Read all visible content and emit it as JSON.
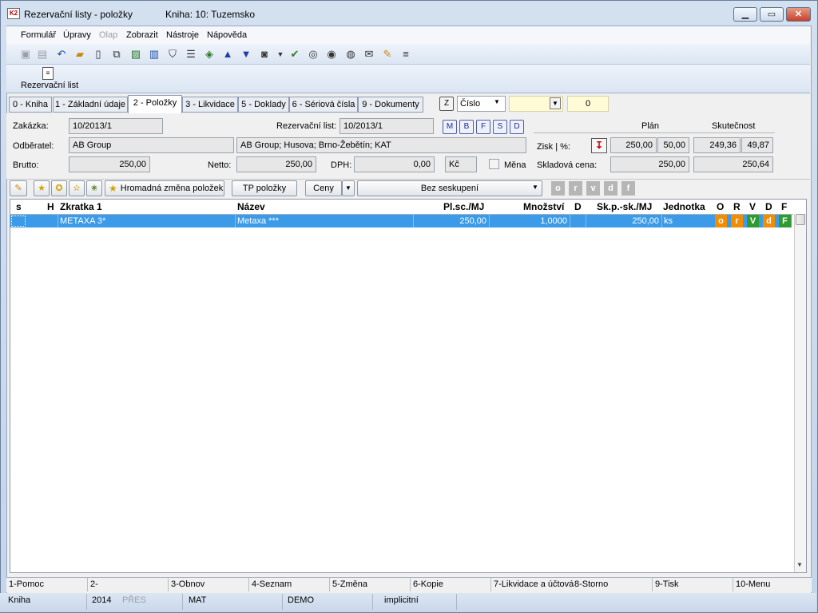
{
  "window": {
    "title": "Rezervační listy - položky",
    "book": "Kniha: 10: Tuzemsko",
    "icon_text": "K2",
    "controls": {
      "minimize": "▁",
      "maximize": "▭",
      "close": "✕"
    }
  },
  "menu": [
    "Formulář",
    "Úpravy",
    "Olap",
    "Zobrazit",
    "Nástroje",
    "Nápověda"
  ],
  "ribbon": {
    "label": "Rezervační list"
  },
  "tabs": [
    "0 - Kniha",
    "1 - Základní údaje",
    "2 - Položky",
    "3 - Likvidace",
    "5 - Doklady",
    "6 - Sériová čísla",
    "9 - Dokumenty"
  ],
  "filter": {
    "z_label": "Z",
    "sort_value": "Číslo",
    "value": "0"
  },
  "form": {
    "zakazka_label": "Zakázka:",
    "zakazka": "10/2013/1",
    "rezervacni_label": "Rezervační list:",
    "rezervacni": "10/2013/1",
    "mini_buttons": [
      "M",
      "B",
      "F",
      "S",
      "D"
    ],
    "odberatel_label": "Odběratel:",
    "odberatel": "AB Group",
    "odberatel_addr": "AB Group; Husova; Brno-Žebětín; KAT",
    "brutto_label": "Brutto:",
    "brutto": "250,00",
    "netto_label": "Netto:",
    "netto": "250,00",
    "dph_label": "DPH:",
    "dph": "0,00",
    "currency": "Kč",
    "mena_label": "Měna",
    "plan_label": "Plán",
    "skutecnost_label": "Skutečnost",
    "zisk_label": "Zisk | %:",
    "zisk_plan": "250,00",
    "zisk_plan_pct": "50,00",
    "zisk_sk": "249,36",
    "zisk_sk_pct": "49,87",
    "skladova_label": "Skladová cena:",
    "skladova_plan": "250,00",
    "skladova_sk": "250,64"
  },
  "item_toolbar": {
    "hromadna": "Hromadná změna položek",
    "tp": "TP položky",
    "ceny": "Ceny",
    "seskupeni": "Bez seskupení",
    "flag_buttons": [
      "o",
      "r",
      "v",
      "d",
      "f"
    ]
  },
  "grid": {
    "headers": {
      "s": "s",
      "h": "H",
      "zkratka": "Zkratka 1",
      "nazev": "Název",
      "plsc": "Pl.sc./MJ",
      "mnozstvi": "Množství",
      "d": "D",
      "skp": "Sk.p.-sk./MJ",
      "jednotka": "Jednotka",
      "o": "O",
      "r": "R",
      "v": "V",
      "dd": "D",
      "f": "F"
    },
    "rows": [
      {
        "zkratka": "METAXA 3*",
        "nazev": "Metaxa ***",
        "plsc": "250,00",
        "mnozstvi": "1,0000",
        "skp": "250,00",
        "jednotka": "ks",
        "o": "o",
        "r": "r",
        "v": "V",
        "d": "d",
        "f": "F"
      }
    ],
    "flag_colors": {
      "o": "#f28c00",
      "r": "#f28c00",
      "v": "#2f9a2f",
      "d": "#f28c00",
      "f": "#2f9a2f"
    }
  },
  "fkeys": [
    "1-Pomoc",
    "2-",
    "3-Obnov",
    "4-Seznam",
    "5-Změna",
    "6-Kopie",
    "7-Likvidace a účtová",
    "8-Storno",
    "9-Tisk",
    "10-Menu"
  ],
  "status": [
    "Kniha",
    "2014",
    "PŘES",
    "MAT",
    "DEMO",
    "implicitní"
  ]
}
